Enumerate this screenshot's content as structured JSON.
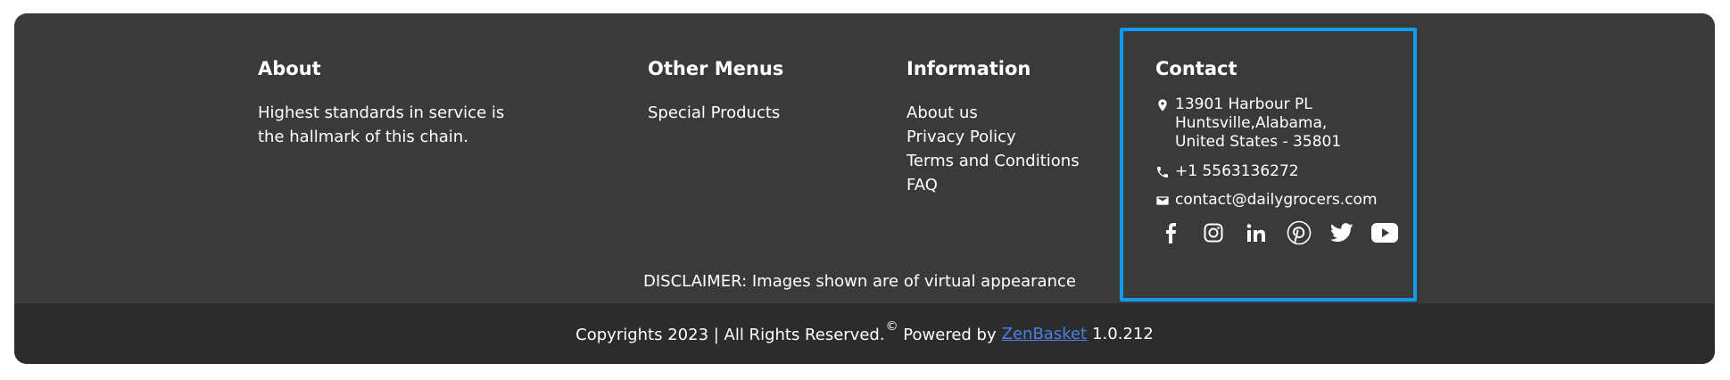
{
  "about": {
    "heading": "About",
    "text_line1": "Highest standards in service is",
    "text_line2": "the hallmark of this chain."
  },
  "other_menus": {
    "heading": "Other Menus",
    "links": [
      "Special Products"
    ]
  },
  "information": {
    "heading": "Information",
    "links": [
      "About us",
      "Privacy Policy",
      "Terms and Conditions",
      "FAQ"
    ]
  },
  "contact": {
    "heading": "Contact",
    "address_line1": "13901 Harbour PL",
    "address_line2": "Huntsville,Alabama,",
    "address_line3": "United States - 35801",
    "phone": "+1 5563136272",
    "email": "contact@dailygrocers.com",
    "social_icons": [
      "facebook-icon",
      "instagram-icon",
      "linkedin-icon",
      "pinterest-icon",
      "twitter-icon",
      "youtube-icon"
    ]
  },
  "disclaimer": "DISCLAIMER: Images shown are of virtual appearance",
  "bottom": {
    "copyright": "Copyrights 2023 | All Rights Reserved.",
    "copyright_symbol": "©",
    "powered_by": "Powered by",
    "brand_link": "ZenBasket",
    "version": "1.0.212"
  },
  "colors": {
    "footer_bg": "#3a3a3a",
    "bottom_bar_bg": "#2c2c2c",
    "highlight_border": "#1399ee",
    "link": "#4a7fe6"
  }
}
